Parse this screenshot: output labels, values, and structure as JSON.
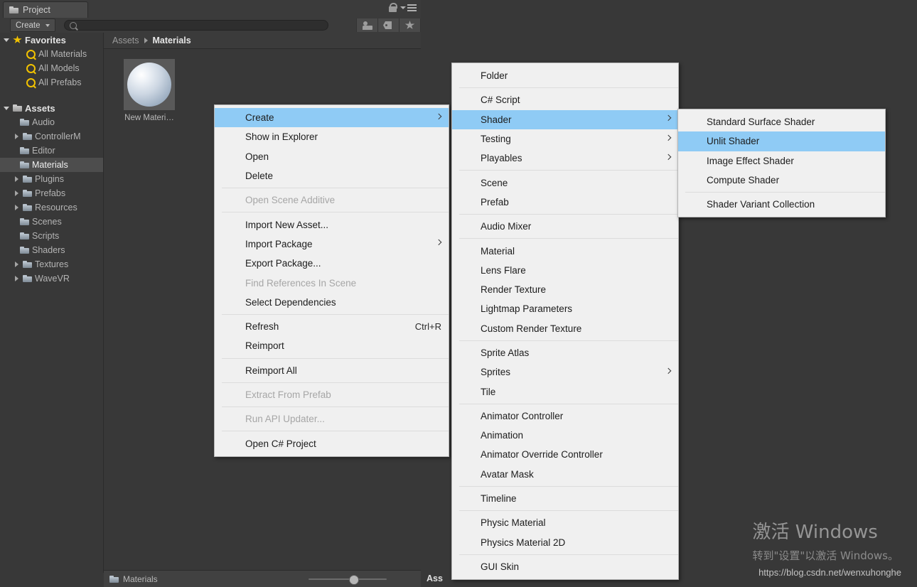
{
  "window": {
    "tab_label": "Project",
    "lock_icon": "lock-icon",
    "menu_icon": "hamburger-menu-icon"
  },
  "toolbar": {
    "create_label": "Create",
    "search_placeholder": "",
    "search_value": "",
    "icons": [
      "person-filter-icon",
      "tag-filter-icon",
      "star-favorite-icon"
    ]
  },
  "breadcrumb": {
    "root": "Assets",
    "current": "Materials"
  },
  "tree": {
    "favorites": {
      "label": "Favorites",
      "items": [
        {
          "label": "All Materials"
        },
        {
          "label": "All Models"
        },
        {
          "label": "All Prefabs"
        }
      ]
    },
    "assets": {
      "label": "Assets",
      "items": [
        {
          "label": "Audio",
          "expandable": false,
          "selected": false
        },
        {
          "label": "ControllerM",
          "expandable": true,
          "selected": false
        },
        {
          "label": "Editor",
          "expandable": false,
          "selected": false
        },
        {
          "label": "Materials",
          "expandable": false,
          "selected": true
        },
        {
          "label": "Plugins",
          "expandable": true,
          "selected": false
        },
        {
          "label": "Prefabs",
          "expandable": true,
          "selected": false
        },
        {
          "label": "Resources",
          "expandable": true,
          "selected": false
        },
        {
          "label": "Scenes",
          "expandable": false,
          "selected": false
        },
        {
          "label": "Scripts",
          "expandable": false,
          "selected": false
        },
        {
          "label": "Shaders",
          "expandable": false,
          "selected": false
        },
        {
          "label": "Textures",
          "expandable": true,
          "selected": false
        },
        {
          "label": "WaveVR",
          "expandable": true,
          "selected": false
        }
      ]
    }
  },
  "assets_grid": {
    "items": [
      {
        "label": "New Materi…",
        "icon": "material-sphere-icon"
      }
    ]
  },
  "statusbar": {
    "label": "Materials",
    "zoom_slider_value": 52,
    "right_tab": "Ass"
  },
  "menus": {
    "create_context": {
      "items": [
        {
          "label": "Create",
          "selected": true,
          "submenu": true
        },
        {
          "label": "Show in Explorer"
        },
        {
          "label": "Open"
        },
        {
          "label": "Delete"
        },
        {
          "separator": true
        },
        {
          "label": "Open Scene Additive",
          "disabled": true
        },
        {
          "separator": true
        },
        {
          "label": "Import New Asset..."
        },
        {
          "label": "Import Package",
          "submenu": true
        },
        {
          "label": "Export Package..."
        },
        {
          "label": "Find References In Scene",
          "disabled": true
        },
        {
          "label": "Select Dependencies"
        },
        {
          "separator": true
        },
        {
          "label": "Refresh",
          "shortcut": "Ctrl+R"
        },
        {
          "label": "Reimport"
        },
        {
          "separator": true
        },
        {
          "label": "Reimport All"
        },
        {
          "separator": true
        },
        {
          "label": "Extract From Prefab",
          "disabled": true
        },
        {
          "separator": true
        },
        {
          "label": "Run API Updater...",
          "disabled": true
        },
        {
          "separator": true
        },
        {
          "label": "Open C# Project"
        }
      ]
    },
    "create_submenu": {
      "items": [
        {
          "label": "Folder"
        },
        {
          "separator": true
        },
        {
          "label": "C# Script"
        },
        {
          "label": "Shader",
          "selected": true,
          "submenu": true
        },
        {
          "label": "Testing",
          "submenu": true
        },
        {
          "label": "Playables",
          "submenu": true
        },
        {
          "separator": true
        },
        {
          "label": "Scene"
        },
        {
          "label": "Prefab"
        },
        {
          "separator": true
        },
        {
          "label": "Audio Mixer"
        },
        {
          "separator": true
        },
        {
          "label": "Material"
        },
        {
          "label": "Lens Flare"
        },
        {
          "label": "Render Texture"
        },
        {
          "label": "Lightmap Parameters"
        },
        {
          "label": "Custom Render Texture"
        },
        {
          "separator": true
        },
        {
          "label": "Sprite Atlas"
        },
        {
          "label": "Sprites",
          "submenu": true
        },
        {
          "label": "Tile"
        },
        {
          "separator": true
        },
        {
          "label": "Animator Controller"
        },
        {
          "label": "Animation"
        },
        {
          "label": "Animator Override Controller"
        },
        {
          "label": "Avatar Mask"
        },
        {
          "separator": true
        },
        {
          "label": "Timeline"
        },
        {
          "separator": true
        },
        {
          "label": "Physic Material"
        },
        {
          "label": "Physics Material 2D"
        },
        {
          "separator": true
        },
        {
          "label": "GUI Skin"
        }
      ]
    },
    "shader_submenu": {
      "items": [
        {
          "label": "Standard Surface Shader"
        },
        {
          "label": "Unlit Shader",
          "selected": true
        },
        {
          "label": "Image Effect Shader"
        },
        {
          "label": "Compute Shader"
        },
        {
          "separator": true
        },
        {
          "label": "Shader Variant Collection"
        }
      ]
    }
  },
  "watermark": {
    "title": "激活 Windows",
    "subtitle": "转到\"设置\"以激活 Windows。"
  },
  "credit": {
    "url": "https://blog.csdn.net/wenxuhonghe"
  },
  "colors": {
    "menu_bg": "#f0f0f0",
    "menu_highlight": "#8fcbf5",
    "editor_bg": "#383838",
    "favorite_gold": "#f2c200"
  }
}
